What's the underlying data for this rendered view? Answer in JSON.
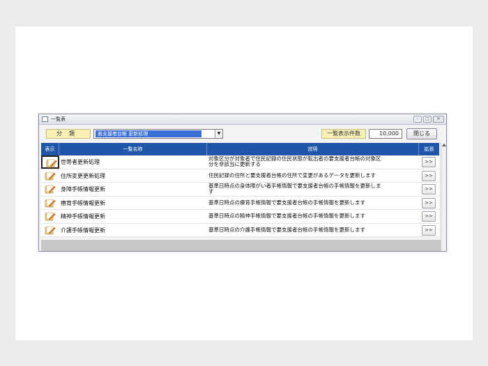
{
  "window": {
    "title": "一覧表"
  },
  "filter": {
    "category_label": "分類",
    "category_value": "善支援者台帳 更新処理",
    "count_label": "一覧表示件数",
    "count_value": "10,000",
    "close_label": "閉じる"
  },
  "table": {
    "headers": {
      "show": "表示",
      "name": "一覧名称",
      "desc": "説明",
      "ext": "拡張"
    },
    "rows": [
      {
        "name": "世帯者更新処理",
        "desc_line1": "対象区分が対象者で住民記録の住民状態が転出者の要支援者台帳の対象区",
        "desc_line2": "分を非該当に更新する",
        "ext": ">>"
      },
      {
        "name": "住所変更更新処理",
        "desc_line1": "住民記録の住所と要支援者台帳の住所で変更があるデータを更新します",
        "desc_line2": "",
        "ext": ">>"
      },
      {
        "name": "身障手帳情報更新",
        "desc_line1": "基準日時点の身体障がい者手帳情報で要支援者台帳の手帳情報を更新しま",
        "desc_line2": "す",
        "ext": ">>"
      },
      {
        "name": "療育手帳情報更新",
        "desc_line1": "基準日時点の療育手帳情報で要支援者台帳の手帳情報を更新します",
        "desc_line2": "",
        "ext": ">>"
      },
      {
        "name": "精神手帳情報更新",
        "desc_line1": "基準日時点の精神手帳情報で要支援者台帳の手帳情報を更新します",
        "desc_line2": "",
        "ext": ">>"
      },
      {
        "name": "介護手帳情報更新",
        "desc_line1": "基準日時点の介護手帳情報で要支援者台帳の手帳情報を更新します",
        "desc_line2": "",
        "ext": ">>"
      }
    ]
  },
  "colors": {
    "header_bg": "#1f56a8",
    "label_bg": "#f7efb6",
    "selection": "#3a6fd8"
  }
}
